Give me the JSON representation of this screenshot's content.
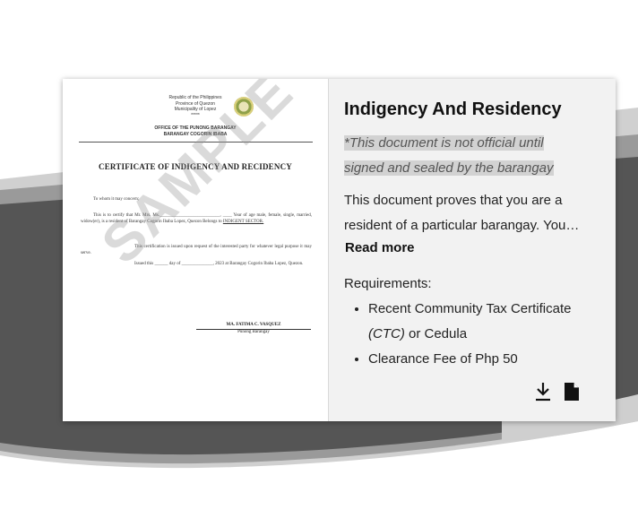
{
  "card": {
    "title": "Indigency And Residency",
    "disclaimer": "*This document is not official until signed and sealed by the barangay",
    "description": "This document proves that you are a resident of a particular barangay. You…",
    "read_more_label": "Read more",
    "requirements_label": "Requirements:",
    "requirements": [
      {
        "text_main": "Recent Community Tax Certificate ",
        "text_italic": "(CTC)",
        "text_tail": " or Cedula"
      },
      {
        "text_main": "Clearance Fee of Php 50",
        "text_italic": "",
        "text_tail": ""
      }
    ],
    "icons": {
      "download": "download-icon",
      "document": "document-icon"
    }
  },
  "preview": {
    "header_lines": [
      "Republic of the Philippines",
      "Province of Quezon",
      "Municipality of Lopez",
      "*****"
    ],
    "office_lines": [
      "OFFICE OF THE PUNONG BARANGAY",
      "BARANGAY COGORIN IBABA"
    ],
    "title": "CERTIFICATE OF INDIGENCY AND RECIDENCY",
    "salutation": "To whom it may concern;",
    "body_prefix": "This is to certify that Mr. Mrs. Ms.___________________________, ____ Year of age male, female, single, married, widow(er), is a resident of Barangay Cogorin Ibaba Lopez, Quezon Belongs to ",
    "body_sector": "INDIGENT SECTOR.",
    "certification": "This certification is issued upon request of the interested party for whatever legal purpose it may serve.",
    "issued": "Issued this ______ day of ______________, 2023 at Barangay Cogorin Ibaba Lopez, Quezon.",
    "signatory_name": "MA. FATIMA C. VASQUEZ",
    "signatory_title": "Punong Barangay",
    "watermark": "SAMPLE"
  },
  "colors": {
    "background_dark": "#555555",
    "background_mid": "#8a8a8a",
    "background_light": "#c4c4c4",
    "card_bg": "#f2f2f2"
  }
}
